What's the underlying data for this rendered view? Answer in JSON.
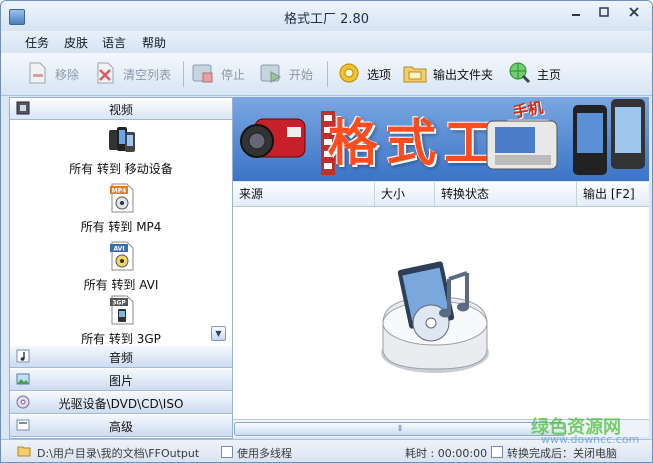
{
  "window": {
    "title": "格式工厂 2.80"
  },
  "menu": [
    "任务",
    "皮肤",
    "语言",
    "帮助"
  ],
  "toolbar": {
    "remove": "移除",
    "clear_list": "清空列表",
    "stop": "停止",
    "start": "开始",
    "options": "选项",
    "output_folder": "输出文件夹",
    "home": "主页"
  },
  "sidebar": {
    "categories": {
      "video": "视频",
      "audio": "音频",
      "image": "图片",
      "rom": "光驱设备\\DVD\\CD\\ISO",
      "advanced": "高级"
    },
    "video_items": [
      {
        "label": "所有 转到 移动设备",
        "icon": "mobile-devices-icon"
      },
      {
        "label": "所有 转到 MP4",
        "icon": "mp4-file-icon",
        "badge": "MP4"
      },
      {
        "label": "所有 转到 AVI",
        "icon": "avi-file-icon",
        "badge": "AVI"
      },
      {
        "label": "所有 转到 3GP",
        "icon": "3gp-file-icon",
        "badge": "3GP"
      }
    ]
  },
  "banner": {
    "text": "格式工厂",
    "sub": "手机"
  },
  "table": {
    "columns": [
      "来源",
      "大小",
      "转换状态",
      "输出 [F2]"
    ]
  },
  "statusbar": {
    "output_path": "D:\\用户目录\\我的文档\\FFOutput",
    "multithread": "使用多线程",
    "elapsed": "耗时 : 00:00:00",
    "after_done": "转换完成后：关闭电脑"
  },
  "watermark": {
    "main": "绿色资源网",
    "sub": "www.downcc.com"
  },
  "colors": {
    "accent": "#3b74c7",
    "banner_text": "#ff4d1f"
  }
}
